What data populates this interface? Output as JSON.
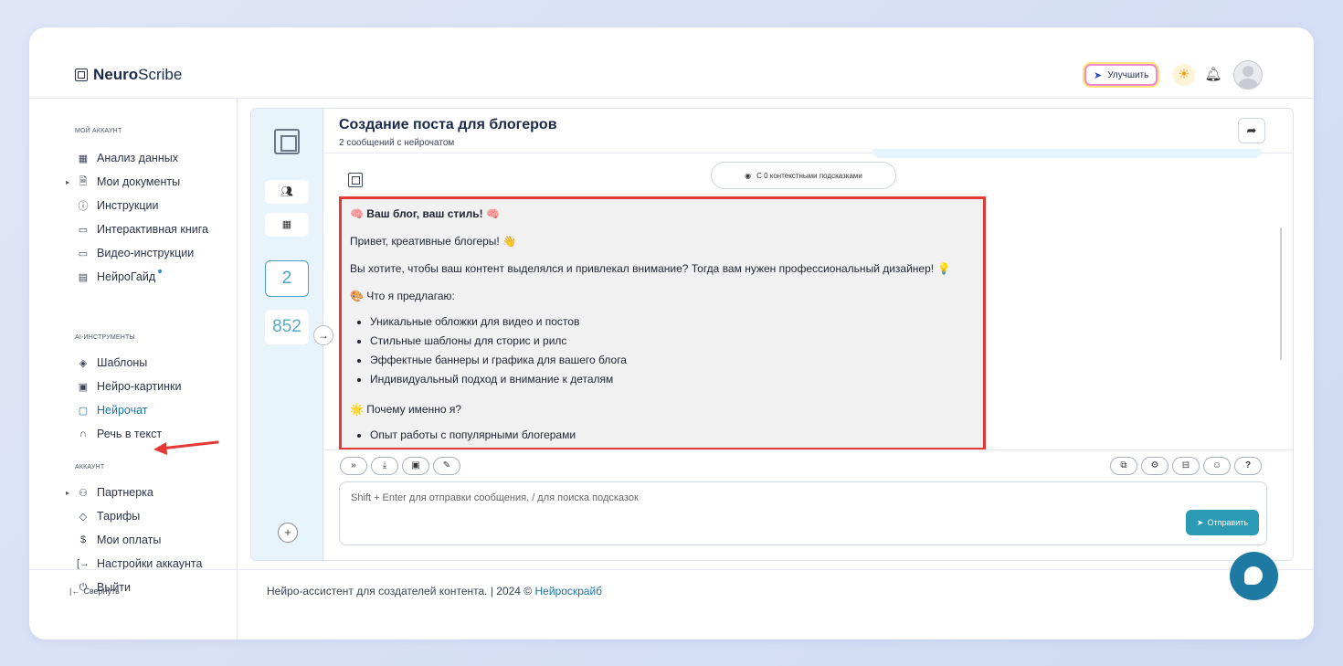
{
  "app": {
    "logo_bold": "Neuro",
    "logo_rest": "Scribe"
  },
  "topbar": {
    "upgrade_label": "Улучшить"
  },
  "sidebar": {
    "section1": "МОЙ АККАУНТ",
    "section2": "AI-ИНСТРУМЕНТЫ",
    "section3": "АККАУНТ",
    "items": [
      {
        "label": "Анализ данных",
        "icon": "grid-icon"
      },
      {
        "label": "Мои документы",
        "icon": "document-icon"
      },
      {
        "label": "Инструкции",
        "icon": "help-circle-icon"
      },
      {
        "label": "Интерактивная книга",
        "icon": "book-icon"
      },
      {
        "label": "Видео-инструкции",
        "icon": "video-icon"
      },
      {
        "label": "НейроГайд",
        "icon": "guide-icon"
      },
      {
        "label": "Шаблоны",
        "icon": "layers-icon"
      },
      {
        "label": "Нейро-картинки",
        "icon": "image-icon"
      },
      {
        "label": "Нейрочат",
        "icon": "chat-icon"
      },
      {
        "label": "Речь в текст",
        "icon": "headphones-icon"
      },
      {
        "label": "Партнерка",
        "icon": "users-icon"
      },
      {
        "label": "Тарифы",
        "icon": "tag-icon"
      },
      {
        "label": "Мои оплаты",
        "icon": "dollar-icon"
      },
      {
        "label": "Настройки аккаунта",
        "icon": "settings-login-icon"
      },
      {
        "label": "Выйти",
        "icon": "power-icon"
      }
    ],
    "collapse_label": "Свернуть"
  },
  "rail": {
    "count": "2",
    "number": "852"
  },
  "chat": {
    "title": "Создание поста для блогеров",
    "subtitle": "2 сообщений с нейрочатом",
    "context_pill": "С 0 контекстными подсказками",
    "answer": {
      "heading": "🧠 Ваш блог, ваш стиль! 🧠",
      "greeting": "Привет, креативные блогеры! 👋",
      "intro": "Вы хотите, чтобы ваш контент выделялся и привлекал внимание? Тогда вам нужен профессиональный дизайнер! 💡",
      "offer_title": "🎨 Что я предлагаю:",
      "offer_items": [
        "Уникальные обложки для видео и постов",
        "Стильные шаблоны для сторис и рилс",
        "Эффектные баннеры и графика для вашего блога",
        "Индивидуальный подход и внимание к деталям"
      ],
      "why_title": "🌟 Почему именно я?",
      "why_items": [
        "Опыт работы с популярными блогерами"
      ]
    },
    "input_placeholder": "Shift + Enter для отправки сообщения, / для поиска подсказок",
    "send_label": "Отправить"
  },
  "footer": {
    "text": "Нейро-ассистент для создателей контента.  | 2024 © ",
    "link": "Нейроскрайб"
  },
  "colors": {
    "accent": "#2a9ab5",
    "highlight": "#e53935",
    "rail_bg": "#e8f4fb"
  }
}
